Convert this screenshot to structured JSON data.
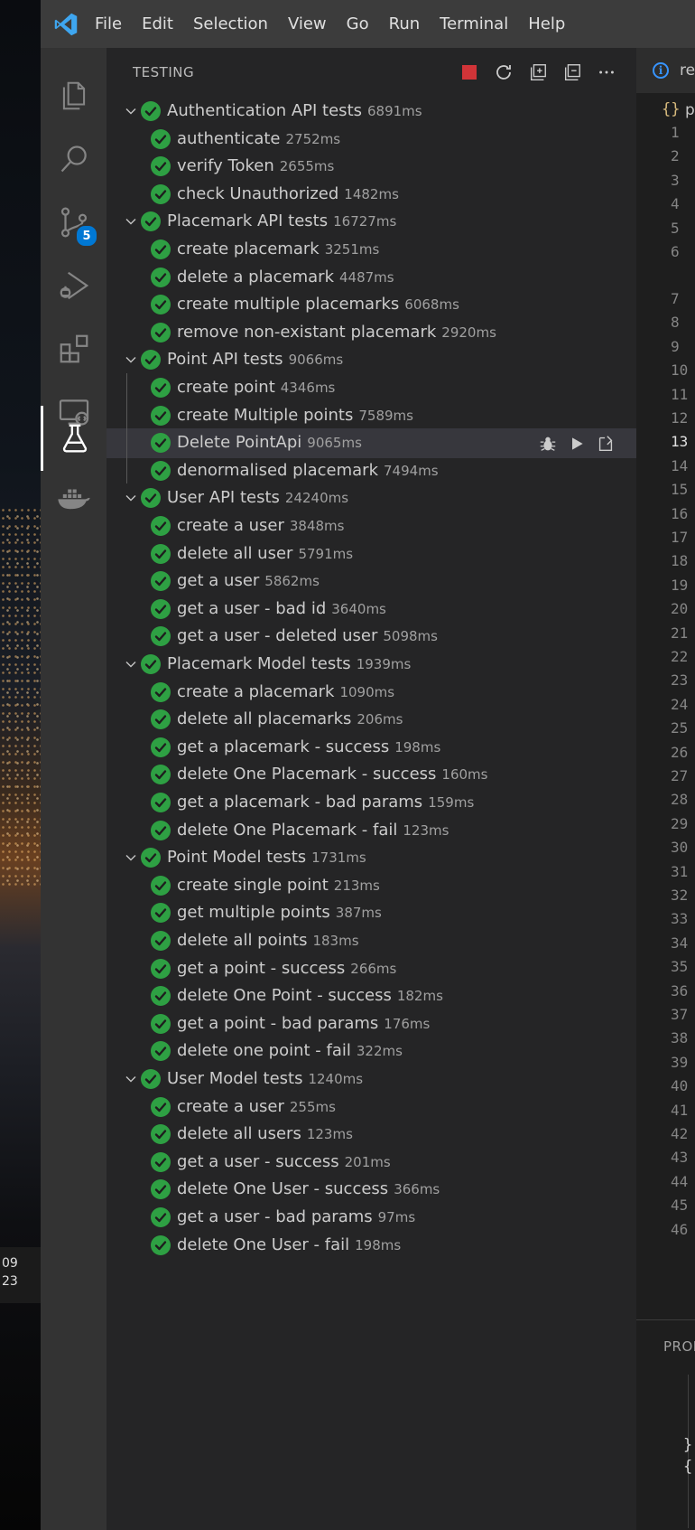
{
  "desktop": {
    "clock": [
      "09",
      "23"
    ]
  },
  "menubar": {
    "items": [
      "File",
      "Edit",
      "Selection",
      "View",
      "Go",
      "Run",
      "Terminal",
      "Help"
    ]
  },
  "activitybar": {
    "items": [
      {
        "name": "explorer-icon",
        "active": false
      },
      {
        "name": "search-icon",
        "active": false
      },
      {
        "name": "source-control-icon",
        "active": false,
        "badge": "5"
      },
      {
        "name": "run-debug-icon",
        "active": false
      },
      {
        "name": "extensions-icon",
        "active": false
      },
      {
        "name": "remote-explorer-icon",
        "active": false
      },
      {
        "name": "testing-flask-icon",
        "active": true
      },
      {
        "name": "docker-icon",
        "active": false
      }
    ]
  },
  "sidebar": {
    "title": "TESTING",
    "actions": [
      "stop-icon",
      "refresh-icon",
      "collapse-all-icon",
      "show-output-icon",
      "more-actions-icon"
    ]
  },
  "tests": [
    {
      "level": 0,
      "name": "Authentication API tests",
      "duration": "6891ms"
    },
    {
      "level": 1,
      "name": "authenticate",
      "duration": "2752ms"
    },
    {
      "level": 1,
      "name": "verify Token",
      "duration": "2655ms"
    },
    {
      "level": 1,
      "name": "check Unauthorized",
      "duration": "1482ms"
    },
    {
      "level": 0,
      "name": "Placemark API tests",
      "duration": "16727ms"
    },
    {
      "level": 1,
      "name": "create placemark",
      "duration": "3251ms"
    },
    {
      "level": 1,
      "name": "delete a placemark",
      "duration": "4487ms"
    },
    {
      "level": 1,
      "name": "create multiple placemarks",
      "duration": "6068ms"
    },
    {
      "level": 1,
      "name": "remove non-existant placemark",
      "duration": "2920ms"
    },
    {
      "level": 0,
      "name": "Point API tests",
      "duration": "9066ms"
    },
    {
      "level": 1,
      "name": "create point",
      "duration": "4346ms"
    },
    {
      "level": 1,
      "name": "create Multiple points",
      "duration": "7589ms"
    },
    {
      "level": 1,
      "name": "Delete PointApi",
      "duration": "9065ms",
      "selected": true
    },
    {
      "level": 1,
      "name": "denormalised placemark",
      "duration": "7494ms"
    },
    {
      "level": 0,
      "name": "User API tests",
      "duration": "24240ms"
    },
    {
      "level": 1,
      "name": "create a user",
      "duration": "3848ms"
    },
    {
      "level": 1,
      "name": "delete all user",
      "duration": "5791ms"
    },
    {
      "level": 1,
      "name": "get a user",
      "duration": "5862ms"
    },
    {
      "level": 1,
      "name": "get a user - bad id",
      "duration": "3640ms"
    },
    {
      "level": 1,
      "name": "get a user - deleted user",
      "duration": "5098ms"
    },
    {
      "level": 0,
      "name": "Placemark Model tests",
      "duration": "1939ms"
    },
    {
      "level": 1,
      "name": "create a placemark",
      "duration": "1090ms"
    },
    {
      "level": 1,
      "name": "delete all placemarks",
      "duration": "206ms"
    },
    {
      "level": 1,
      "name": "get a placemark - success",
      "duration": "198ms"
    },
    {
      "level": 1,
      "name": "delete One Placemark - success",
      "duration": "160ms"
    },
    {
      "level": 1,
      "name": "get a placemark - bad params",
      "duration": "159ms"
    },
    {
      "level": 1,
      "name": "delete One Placemark - fail",
      "duration": "123ms"
    },
    {
      "level": 0,
      "name": "Point Model tests",
      "duration": "1731ms"
    },
    {
      "level": 1,
      "name": "create single point",
      "duration": "213ms"
    },
    {
      "level": 1,
      "name": "get multiple points",
      "duration": "387ms"
    },
    {
      "level": 1,
      "name": "delete all points",
      "duration": "183ms"
    },
    {
      "level": 1,
      "name": "get a point - success",
      "duration": "266ms"
    },
    {
      "level": 1,
      "name": "delete One Point - success",
      "duration": "182ms"
    },
    {
      "level": 1,
      "name": "get a point - bad params",
      "duration": "176ms"
    },
    {
      "level": 1,
      "name": "delete one point - fail",
      "duration": "322ms"
    },
    {
      "level": 0,
      "name": "User Model tests",
      "duration": "1240ms"
    },
    {
      "level": 1,
      "name": "create a user",
      "duration": "255ms"
    },
    {
      "level": 1,
      "name": "delete all users",
      "duration": "123ms"
    },
    {
      "level": 1,
      "name": "get a user - success",
      "duration": "201ms"
    },
    {
      "level": 1,
      "name": "delete One User - success",
      "duration": "366ms"
    },
    {
      "level": 1,
      "name": "get a user - bad params",
      "duration": "97ms"
    },
    {
      "level": 1,
      "name": "delete One User - fail",
      "duration": "198ms"
    }
  ],
  "selected_row_actions": [
    "debug-test-icon",
    "run-test-icon",
    "go-to-test-icon"
  ],
  "editor": {
    "tab_label": "re",
    "breadcrumb_brace": "{}",
    "breadcrumb_text": "p",
    "line_numbers": [
      "1",
      "2",
      "3",
      "4",
      "5",
      "6",
      "7",
      "8",
      "9",
      "10",
      "11",
      "12",
      "13",
      "14",
      "15",
      "16",
      "17",
      "18",
      "19",
      "20",
      "21",
      "22",
      "23",
      "24",
      "25",
      "26",
      "27",
      "28",
      "29",
      "30",
      "31",
      "32",
      "33",
      "34",
      "35",
      "36",
      "37",
      "38",
      "39",
      "40",
      "41",
      "42",
      "43",
      "44",
      "45",
      "46"
    ],
    "current_line": "13",
    "panel_tab": "PROI",
    "panel_code": [
      "}",
      "{"
    ]
  },
  "colors": {
    "pass": "#2ea043",
    "accent": "#0078d4",
    "stop": "#d13438"
  }
}
